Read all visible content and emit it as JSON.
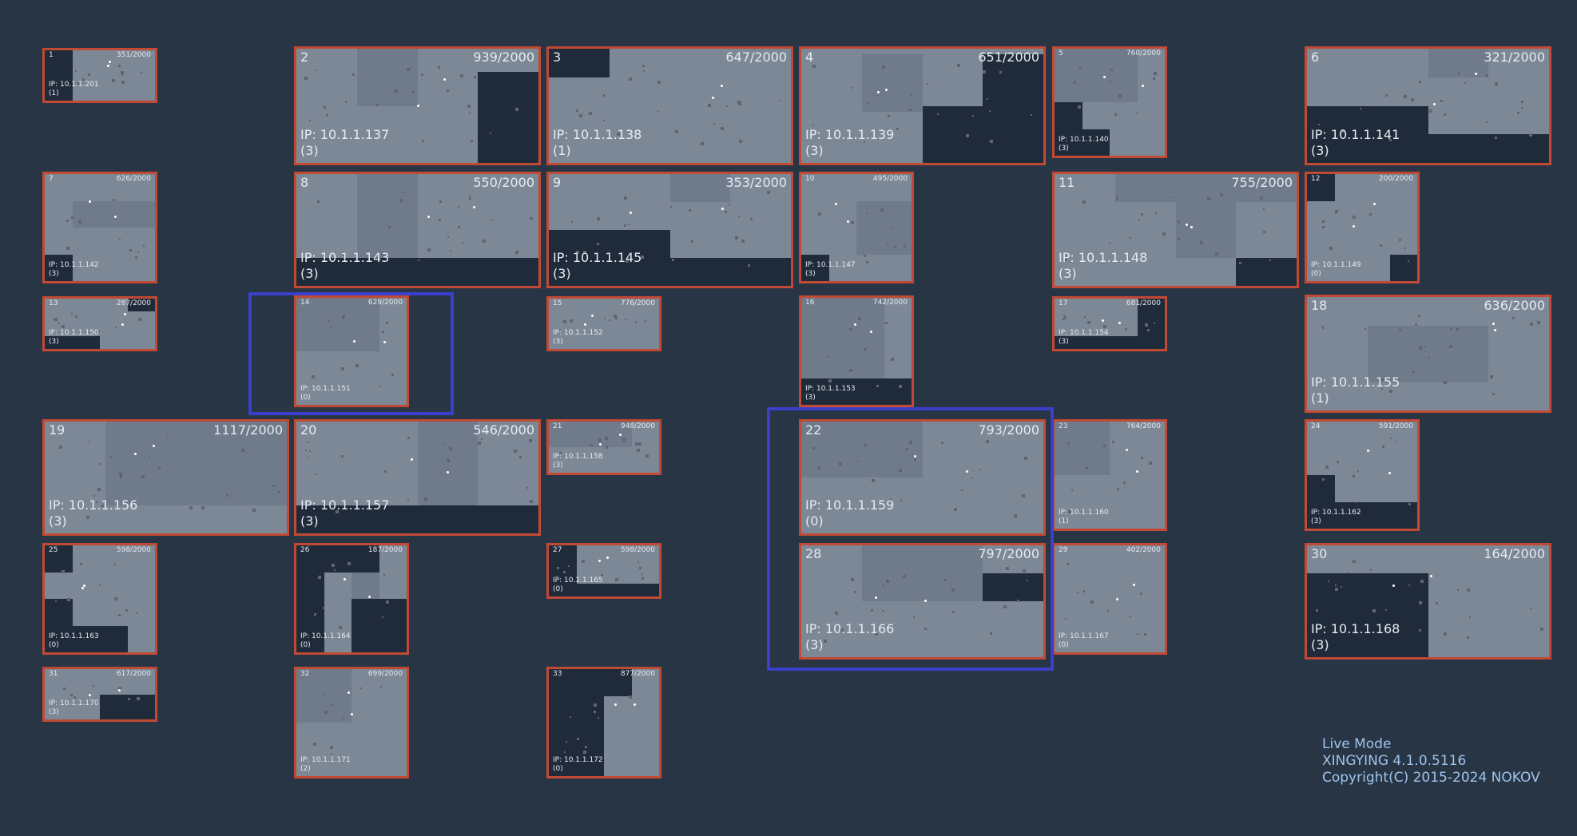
{
  "cameras": [
    {
      "num": "1",
      "count": "351/2000",
      "ip": "IP: 10.1.1.201",
      "status": "(1)"
    },
    {
      "num": "2",
      "count": "939/2000",
      "ip": "IP: 10.1.1.137",
      "status": "(3)"
    },
    {
      "num": "3",
      "count": "647/2000",
      "ip": "IP: 10.1.1.138",
      "status": "(1)"
    },
    {
      "num": "4",
      "count": "651/2000",
      "ip": "IP: 10.1.1.139",
      "status": "(3)"
    },
    {
      "num": "5",
      "count": "760/2000",
      "ip": "IP: 10.1.1.140",
      "status": "(3)"
    },
    {
      "num": "6",
      "count": "321/2000",
      "ip": "IP: 10.1.1.141",
      "status": "(3)"
    },
    {
      "num": "7",
      "count": "626/2000",
      "ip": "IP: 10.1.1.142",
      "status": "(3)"
    },
    {
      "num": "8",
      "count": "550/2000",
      "ip": "IP: 10.1.1.143",
      "status": "(3)"
    },
    {
      "num": "9",
      "count": "353/2000",
      "ip": "IP: 10.1.1.145",
      "status": "(3)"
    },
    {
      "num": "10",
      "count": "495/2000",
      "ip": "IP: 10.1.1.147",
      "status": "(3)"
    },
    {
      "num": "11",
      "count": "755/2000",
      "ip": "IP: 10.1.1.148",
      "status": "(3)"
    },
    {
      "num": "12",
      "count": "200/2000",
      "ip": "IP: 10.1.1.149",
      "status": "(0)"
    },
    {
      "num": "13",
      "count": "287/2000",
      "ip": "IP: 10.1.1.150",
      "status": "(3)"
    },
    {
      "num": "14",
      "count": "629/2000",
      "ip": "IP: 10.1.1.151",
      "status": "(0)"
    },
    {
      "num": "15",
      "count": "776/2000",
      "ip": "IP: 10.1.1.152",
      "status": "(3)"
    },
    {
      "num": "16",
      "count": "742/2000",
      "ip": "IP: 10.1.1.153",
      "status": "(3)"
    },
    {
      "num": "17",
      "count": "681/2000",
      "ip": "IP: 10.1.1.154",
      "status": "(3)"
    },
    {
      "num": "18",
      "count": "636/2000",
      "ip": "IP: 10.1.1.155",
      "status": "(1)"
    },
    {
      "num": "19",
      "count": "1117/2000",
      "ip": "IP: 10.1.1.156",
      "status": "(3)"
    },
    {
      "num": "20",
      "count": "546/2000",
      "ip": "IP: 10.1.1.157",
      "status": "(3)"
    },
    {
      "num": "21",
      "count": "948/2000",
      "ip": "IP: 10.1.1.158",
      "status": "(3)"
    },
    {
      "num": "22",
      "count": "793/2000",
      "ip": "IP: 10.1.1.159",
      "status": "(0)"
    },
    {
      "num": "23",
      "count": "764/2000",
      "ip": "IP: 10.1.1.160",
      "status": "(1)"
    },
    {
      "num": "24",
      "count": "591/2000",
      "ip": "IP: 10.1.1.162",
      "status": "(3)"
    },
    {
      "num": "25",
      "count": "598/2000",
      "ip": "IP: 10.1.1.163",
      "status": "(0)"
    },
    {
      "num": "26",
      "count": "187/2000",
      "ip": "IP: 10.1.1.164",
      "status": "(0)"
    },
    {
      "num": "27",
      "count": "598/2000",
      "ip": "IP: 10.1.1.165",
      "status": "(0)"
    },
    {
      "num": "28",
      "count": "797/2000",
      "ip": "IP: 10.1.1.166",
      "status": "(3)"
    },
    {
      "num": "29",
      "count": "402/2000",
      "ip": "IP: 10.1.1.167",
      "status": "(0)"
    },
    {
      "num": "30",
      "count": "164/2000",
      "ip": "IP: 10.1.1.168",
      "status": "(3)"
    },
    {
      "num": "31",
      "count": "617/2000",
      "ip": "IP: 10.1.1.170",
      "status": "(3)"
    },
    {
      "num": "32",
      "count": "699/2000",
      "ip": "IP: 10.1.1.171",
      "status": "(2)"
    },
    {
      "num": "33",
      "count": "877/2000",
      "ip": "IP: 10.1.1.172",
      "status": "(0)"
    }
  ],
  "info": {
    "mode": "Live Mode",
    "version": "XINGYING 4.1.0.5116",
    "copyright": "Copyright(C) 2015-2024 NOKOV"
  },
  "colors": {
    "background": "#283545",
    "cell_border": "#c24a34",
    "selection": "#3a3fcc",
    "info_text": "#9fc4ea"
  }
}
